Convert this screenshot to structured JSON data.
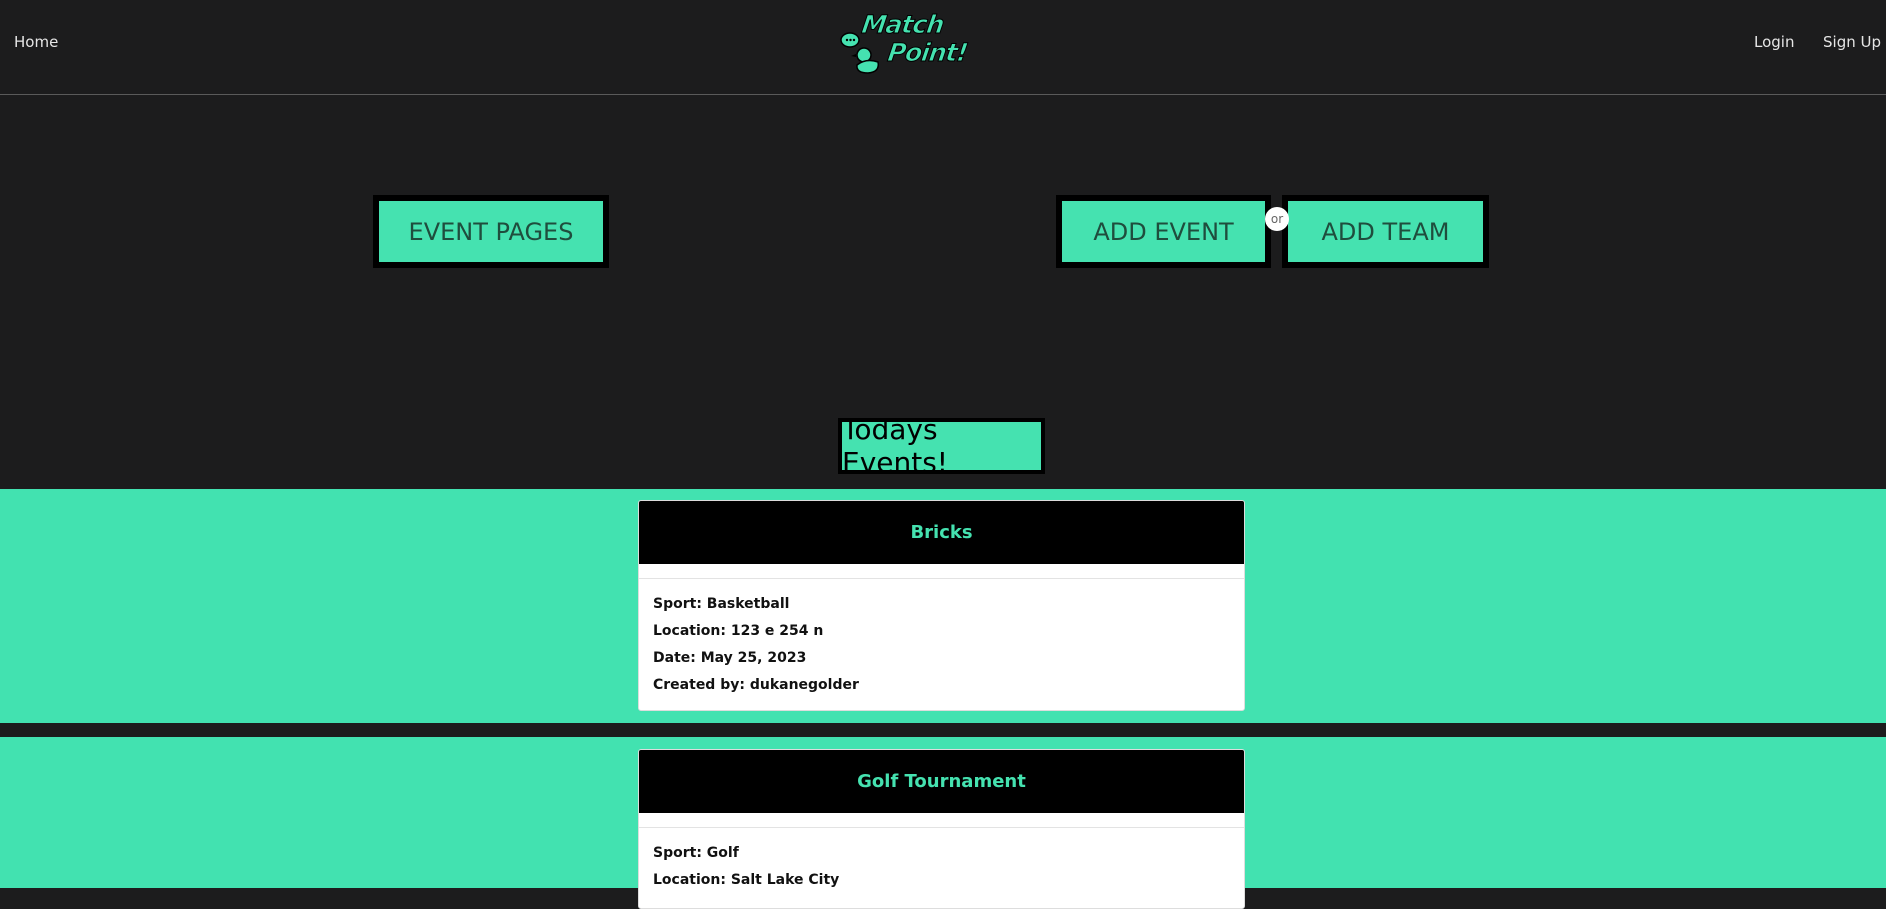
{
  "nav": {
    "home": "Home",
    "login": "Login",
    "signup": "Sign Up",
    "logo_line1": "Match",
    "logo_line2": "Point!"
  },
  "hero": {
    "event_pages": "EVENT PAGES",
    "add_event": "ADD EVENT",
    "or": "or",
    "add_team": "ADD TEAM"
  },
  "section_title": "Todays Events!",
  "events": [
    {
      "name": "Bricks",
      "sport": "Sport: Basketball",
      "location": "Location: 123 e 254 n",
      "date": "Date: May 25, 2023",
      "created_by": "Created by: dukanegolder"
    },
    {
      "name": "Golf Tournament",
      "sport": "Sport: Golf",
      "location": "Location: Salt Lake City"
    }
  ],
  "colors": {
    "accent": "#45e2b0",
    "background": "#1c1c1d",
    "card_header": "#000000"
  },
  "icons": {
    "logo": "duck-chat-logo"
  }
}
